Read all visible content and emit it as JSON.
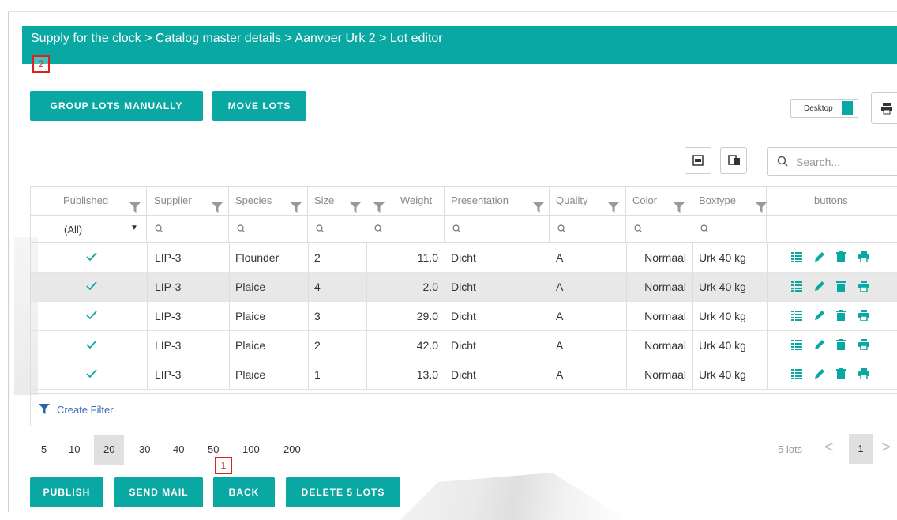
{
  "breadcrumb": {
    "link1": "Supply for the clock",
    "sep1": " > ",
    "link2": "Catalog master details",
    "sep2": " > ",
    "current1": "Aanvoer Urk 2",
    "sep3": " > ",
    "current2": "Lot editor"
  },
  "markers": {
    "top": "2",
    "bottom": "1"
  },
  "toolbar": {
    "group_lots": "GROUP LOTS MANUALLY",
    "move_lots": "MOVE LOTS",
    "device_label": "Desktop"
  },
  "search": {
    "placeholder": "Search..."
  },
  "columns": {
    "published": "Published",
    "supplier": "Supplier",
    "species": "Species",
    "size": "Size",
    "weight": "Weight",
    "presentation": "Presentation",
    "quality": "Quality",
    "color": "Color",
    "boxtype": "Boxtype",
    "buttons": "buttons"
  },
  "filter": {
    "published_value": "(All)"
  },
  "rows": [
    {
      "supplier": "LIP-3",
      "species": "Flounder",
      "size": "2",
      "weight": "11.0",
      "presentation": "Dicht",
      "quality": "A",
      "color": "Normaal",
      "boxtype": "Urk 40 kg"
    },
    {
      "supplier": "LIP-3",
      "species": "Plaice",
      "size": "4",
      "weight": "2.0",
      "presentation": "Dicht",
      "quality": "A",
      "color": "Normaal",
      "boxtype": "Urk 40 kg"
    },
    {
      "supplier": "LIP-3",
      "species": "Plaice",
      "size": "3",
      "weight": "29.0",
      "presentation": "Dicht",
      "quality": "A",
      "color": "Normaal",
      "boxtype": "Urk 40 kg"
    },
    {
      "supplier": "LIP-3",
      "species": "Plaice",
      "size": "2",
      "weight": "42.0",
      "presentation": "Dicht",
      "quality": "A",
      "color": "Normaal",
      "boxtype": "Urk 40 kg"
    },
    {
      "supplier": "LIP-3",
      "species": "Plaice",
      "size": "1",
      "weight": "13.0",
      "presentation": "Dicht",
      "quality": "A",
      "color": "Normaal",
      "boxtype": "Urk 40 kg"
    }
  ],
  "create_filter": "Create Filter",
  "pager": {
    "sizes": [
      "5",
      "10",
      "20",
      "30",
      "40",
      "50",
      "100",
      "200"
    ],
    "selected": "20",
    "count": "5 lots",
    "prev": "<",
    "page": "1",
    "next": ">"
  },
  "footer": {
    "publish": "PUBLISH",
    "send_mail": "SEND MAIL",
    "back": "BACK",
    "delete": "DELETE 5 LOTS"
  },
  "colors": {
    "accent": "#0aa8a3",
    "check": "#0aa8a3",
    "link": "#3b6db3"
  },
  "icons": {
    "row_actions": [
      "details-icon",
      "edit-icon",
      "delete-icon",
      "print-icon"
    ],
    "toolbar": [
      "export-icon",
      "column-chooser-icon",
      "search-icon",
      "printer-icon"
    ]
  }
}
